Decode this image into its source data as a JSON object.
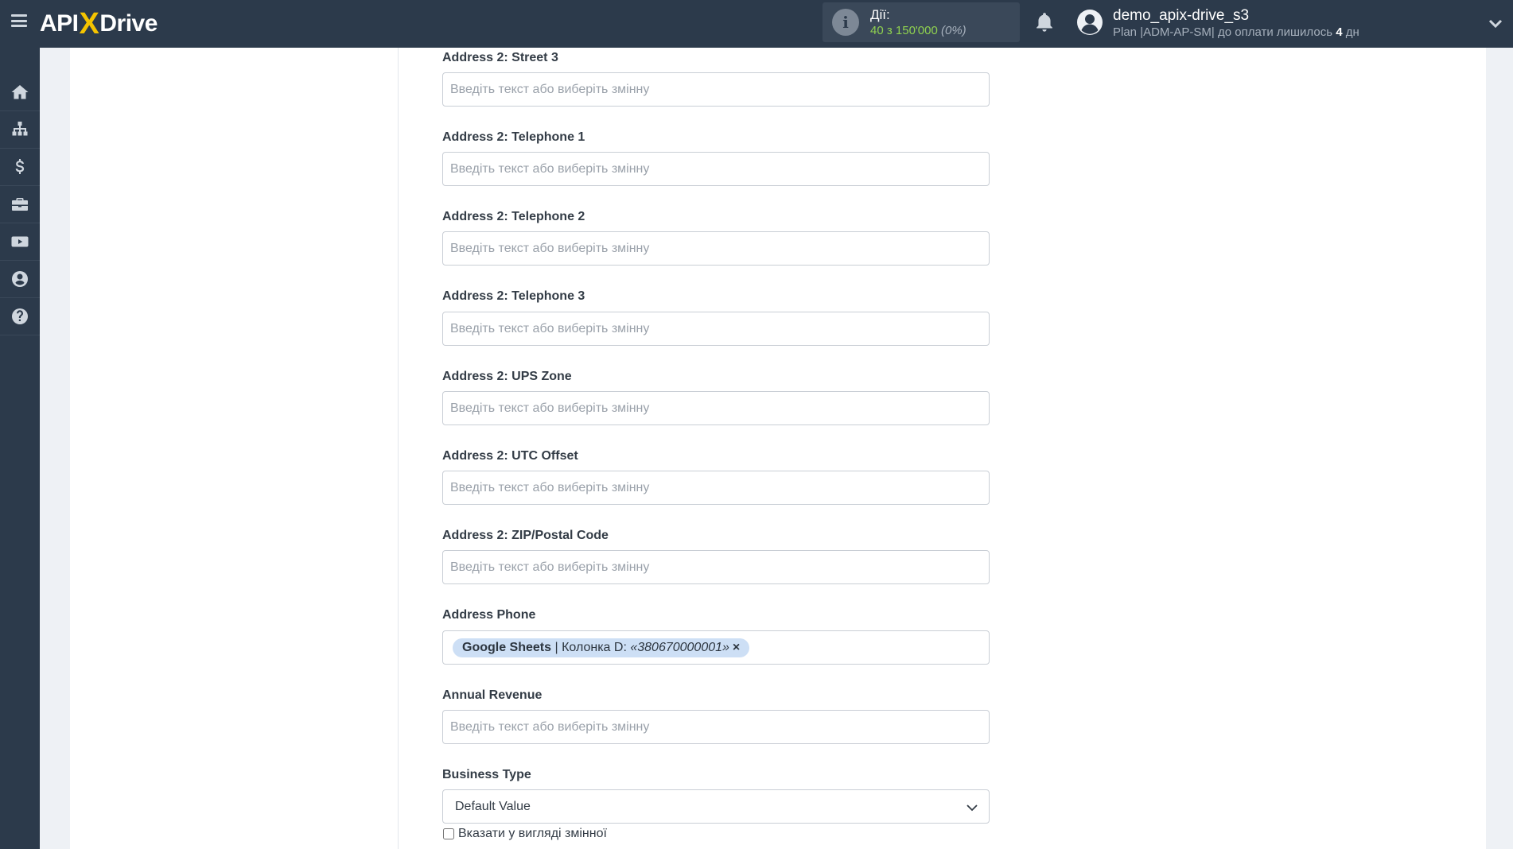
{
  "header": {
    "logo_api": "API",
    "logo_x": "X",
    "logo_drive": "Drive",
    "actions_label": "Дії:",
    "actions_value": "40 з 150'000",
    "actions_percent": "(0%)",
    "user_name": "demo_apix-drive_s3",
    "plan_text": "Plan |ADM-AP-SM| до оплати лишилось ",
    "plan_days": "4",
    "plan_days_unit": " дн"
  },
  "sidebar": {
    "items": [
      "home-icon",
      "sitemap-icon",
      "dollar-icon",
      "briefcase-icon",
      "youtube-icon",
      "user-icon",
      "help-icon"
    ]
  },
  "form": {
    "placeholder": "Введіть текст або виберіть змінну",
    "fields": [
      {
        "label": "Address 2: Street 3"
      },
      {
        "label": "Address 2: Telephone 1"
      },
      {
        "label": "Address 2: Telephone 2"
      },
      {
        "label": "Address 2: Telephone 3"
      },
      {
        "label": "Address 2: UPS Zone"
      },
      {
        "label": "Address 2: UTC Offset"
      },
      {
        "label": "Address 2: ZIP/Postal Code"
      },
      {
        "label": "Address Phone"
      },
      {
        "label": "Annual Revenue"
      },
      {
        "label": "Business Type"
      }
    ],
    "address_phone_tag": {
      "source": "Google Sheets",
      "column": " | Колонка D: ",
      "value": "«380670000001»",
      "remove": "×"
    },
    "business_type_value": "Default Value",
    "checkbox_label": "Вказати у вигляді змінної"
  },
  "colors": {
    "topbar": "#2c3a4b",
    "accent_yellow": "#f5c400",
    "actions_green": "#8fd14f",
    "tag_bg": "#cddff5"
  }
}
